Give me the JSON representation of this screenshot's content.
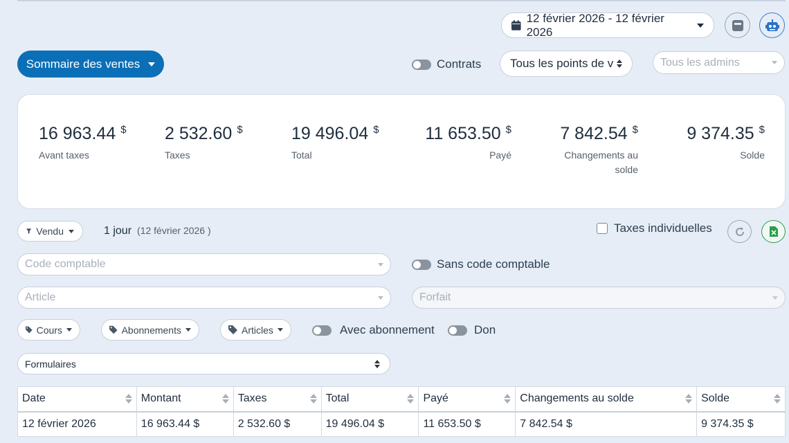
{
  "header": {
    "date_range": "12 février 2026 - 12 février 2026"
  },
  "report_selector": {
    "label": "Sommaire des ventes"
  },
  "contrats_toggle": {
    "label": "Contrats"
  },
  "points_select": {
    "value": "Tous les points de v"
  },
  "admins_select": {
    "placeholder": "Tous les admins"
  },
  "stats": [
    {
      "value": "16 963.44",
      "currency": "$",
      "label": "Avant taxes"
    },
    {
      "value": "2 532.60",
      "currency": "$",
      "label": "Taxes"
    },
    {
      "value": "19 496.04",
      "currency": "$",
      "label": "Total"
    },
    {
      "value": "11 653.50",
      "currency": "$",
      "label": "Payé"
    },
    {
      "value": "7 842.54",
      "currency": "$",
      "label": "Changements au solde"
    },
    {
      "value": "9 374.35",
      "currency": "$",
      "label": "Solde"
    }
  ],
  "filters": {
    "vendu_label": "Vendu",
    "period_label": "1 jour",
    "period_date": "(12 février 2026 )",
    "taxes_individuelles": "Taxes individuelles",
    "code_comptable_placeholder": "Code comptable",
    "sans_code_comptable": "Sans code comptable",
    "article_placeholder": "Article",
    "forfait_placeholder": "Forfait",
    "cours": "Cours",
    "abonnements": "Abonnements",
    "articles": "Articles",
    "avec_abonnement": "Avec abonnement",
    "don": "Don",
    "formulaires": "Formulaires"
  },
  "table": {
    "headers": [
      "Date",
      "Montant",
      "Taxes",
      "Total",
      "Payé",
      "Changements au solde",
      "Solde"
    ],
    "rows": [
      [
        "12 février 2026",
        "16 963.44 $",
        "2 532.60 $",
        "19 496.04 $",
        "11 653.50 $",
        "7 842.54 $",
        "9 374.35 $"
      ]
    ]
  },
  "colors": {
    "primary": "#0a6fb7",
    "background": "#e6edf6",
    "excel": "#2a9d4b"
  }
}
